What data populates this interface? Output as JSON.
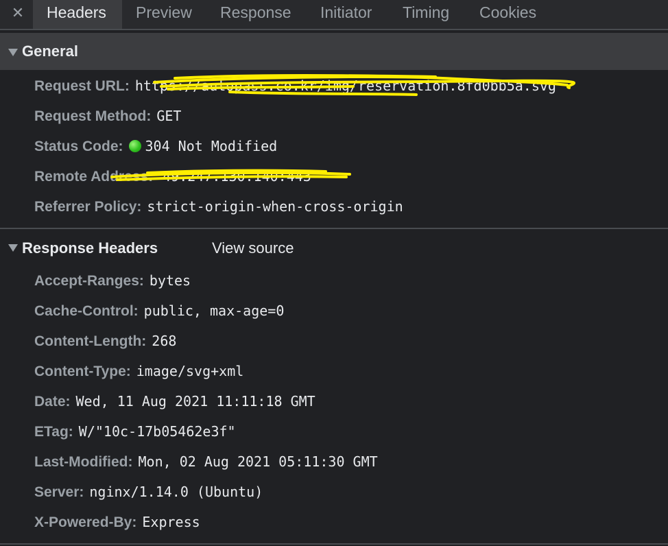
{
  "tabs": {
    "close_glyph": "✕",
    "items": [
      "Headers",
      "Preview",
      "Response",
      "Initiator",
      "Timing",
      "Cookies"
    ],
    "active": "Headers"
  },
  "general": {
    "title": "General",
    "request_url": {
      "key": "Request URL:",
      "value": "https://autopass.co.kr/img/reservation.8fd0bb5a.svg"
    },
    "request_method": {
      "key": "Request Method:",
      "value": "GET"
    },
    "status_code": {
      "key": "Status Code:",
      "value": "304 Not Modified",
      "status_color": "#31c120"
    },
    "remote_address": {
      "key": "Remote Address:",
      "value": "49.247.130.140:443"
    },
    "referrer_policy": {
      "key": "Referrer Policy:",
      "value": "strict-origin-when-cross-origin"
    }
  },
  "response_headers": {
    "title": "Response Headers",
    "view_source": "View source",
    "rows": [
      {
        "key": "Accept-Ranges:",
        "value": "bytes"
      },
      {
        "key": "Cache-Control:",
        "value": "public, max-age=0"
      },
      {
        "key": "Content-Length:",
        "value": "268"
      },
      {
        "key": "Content-Type:",
        "value": "image/svg+xml"
      },
      {
        "key": "Date:",
        "value": "Wed, 11 Aug 2021 11:11:18 GMT"
      },
      {
        "key": "ETag:",
        "value": "W/\"10c-17b05462e3f\""
      },
      {
        "key": "Last-Modified:",
        "value": "Mon, 02 Aug 2021 05:11:30 GMT"
      },
      {
        "key": "Server:",
        "value": "nginx/1.14.0 (Ubuntu)"
      },
      {
        "key": "X-Powered-By:",
        "value": "Express"
      }
    ]
  },
  "colors": {
    "background": "#202124",
    "header_bg": "#3c3d40",
    "key_text": "#9aa0a6",
    "value_text": "#e8eaed",
    "redaction": "#ffee00"
  }
}
